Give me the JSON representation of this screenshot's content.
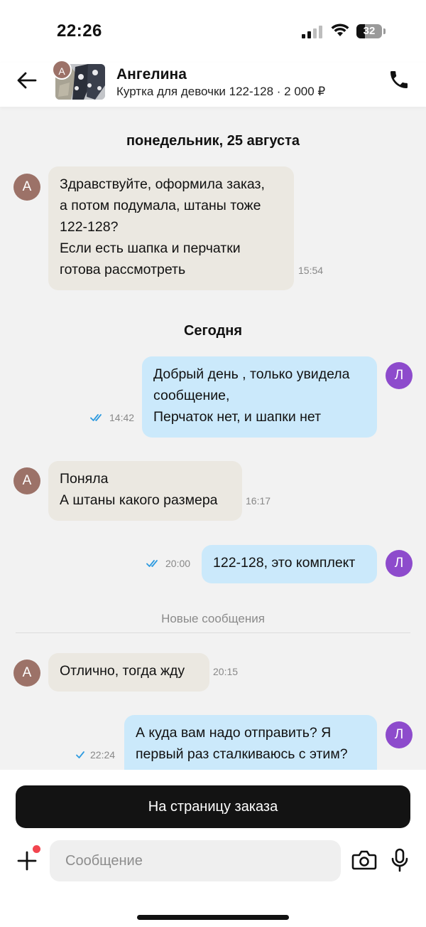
{
  "status_bar": {
    "time": "22:26",
    "battery": "32"
  },
  "header": {
    "avatar_letter": "А",
    "name": "Ангелина",
    "subtitle": "Куртка для девочки 122-128 · 2 000 ₽"
  },
  "chat": {
    "day1": "понедельник, 25 августа",
    "day2": "Сегодня",
    "new_messages": "Новые сообщения",
    "incoming_letter": "А",
    "outgoing_letter": "Л",
    "messages": [
      {
        "direction": "in",
        "lines": [
          "Здравствуйте, оформила заказ,",
          "а потом подумала, штаны тоже",
          "122-128?",
          "Если есть шапка и перчатки",
          "готова рассмотреть"
        ],
        "time": "15:54"
      },
      {
        "direction": "out",
        "lines": [
          "Добрый день , только увидела",
          "сообщение,",
          "Перчаток нет, и шапки нет"
        ],
        "time": "14:42",
        "status": "read"
      },
      {
        "direction": "in",
        "lines": [
          "Поняла",
          "А штаны какого размера"
        ],
        "time": "16:17"
      },
      {
        "direction": "out",
        "lines": [
          "122-128, это комплект"
        ],
        "time": "20:00",
        "status": "read"
      },
      {
        "direction": "in",
        "lines": [
          "Отлично, тогда жду"
        ],
        "time": "20:15"
      },
      {
        "direction": "out",
        "lines": [
          "А куда вам надо отправить? Я",
          "первый раз сталкиваюсь с этим?"
        ],
        "time": "22:24",
        "status": "sent"
      }
    ]
  },
  "footer": {
    "order_button": "На страницу заказа",
    "message_placeholder": "Сообщение"
  },
  "colors": {
    "incoming_bubble": "#ebe8e1",
    "outgoing_bubble": "#cbe9fb",
    "incoming_avatar": "#9c7268",
    "outgoing_avatar": "#8d4bcc",
    "read_ticks": "#2f9be0",
    "primary_button": "#131313",
    "notification_dot": "#f2454f"
  },
  "icons": [
    "back-arrow-icon",
    "phone-icon",
    "double-check-icon",
    "check-icon",
    "plus-icon",
    "camera-icon",
    "microphone-icon",
    "signal-icon",
    "wifi-icon",
    "battery-icon"
  ]
}
